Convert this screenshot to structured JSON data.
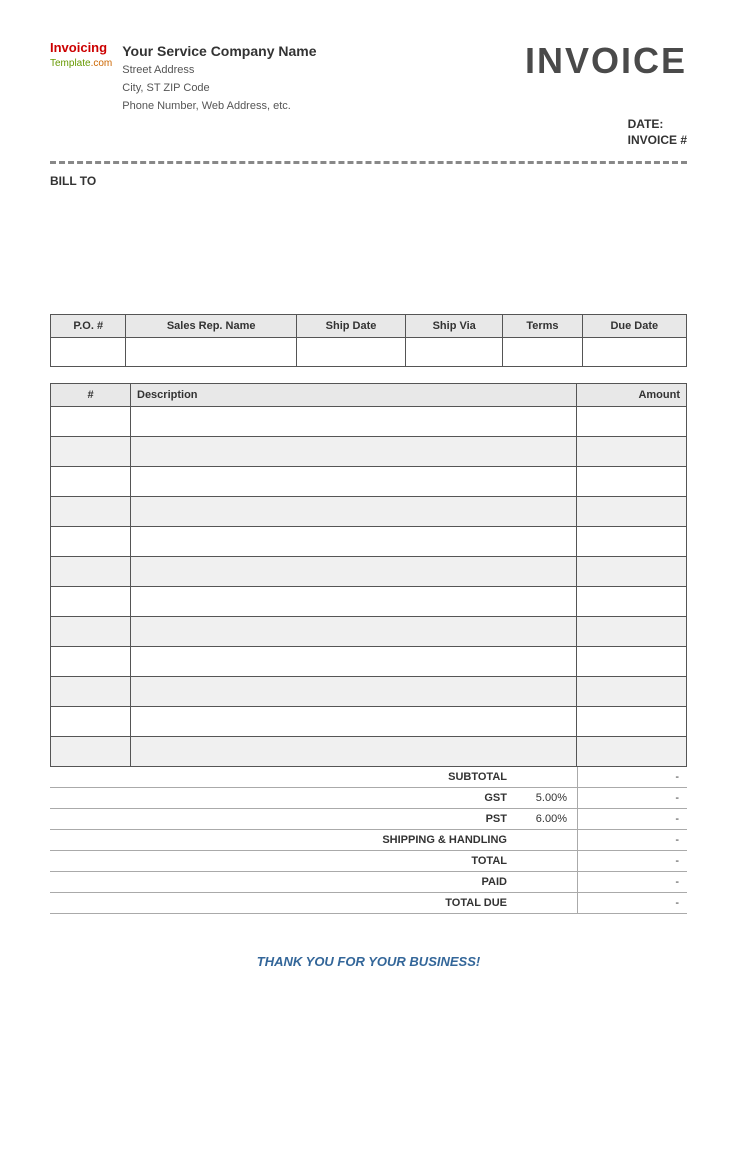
{
  "header": {
    "logo": {
      "invoicing_part1": "Invoicing",
      "template_part1": "Template",
      "template_part2": ".com"
    },
    "company": {
      "name": "Your Service Company Name",
      "street": "Street Address",
      "city": "City, ST  ZIP Code",
      "phone": "Phone Number, Web Address, etc."
    },
    "invoice_title": "INVOICE",
    "date_label": "DATE:",
    "invoice_num_label": "INVOICE #"
  },
  "bill_to": {
    "label": "BILL TO"
  },
  "info_table": {
    "columns": [
      "P.O. #",
      "Sales Rep. Name",
      "Ship Date",
      "Ship Via",
      "Terms",
      "Due Date"
    ],
    "row": [
      "",
      "",
      "",
      "",
      "",
      ""
    ]
  },
  "items_table": {
    "col_num": "#",
    "col_desc": "Description",
    "col_amt": "Amount",
    "rows": [
      {
        "num": "",
        "desc": "",
        "amt": ""
      },
      {
        "num": "",
        "desc": "",
        "amt": ""
      },
      {
        "num": "",
        "desc": "",
        "amt": ""
      },
      {
        "num": "",
        "desc": "",
        "amt": ""
      },
      {
        "num": "",
        "desc": "",
        "amt": ""
      },
      {
        "num": "",
        "desc": "",
        "amt": ""
      },
      {
        "num": "",
        "desc": "",
        "amt": ""
      },
      {
        "num": "",
        "desc": "",
        "amt": ""
      },
      {
        "num": "",
        "desc": "",
        "amt": ""
      },
      {
        "num": "",
        "desc": "",
        "amt": ""
      },
      {
        "num": "",
        "desc": "",
        "amt": ""
      },
      {
        "num": "",
        "desc": "",
        "amt": ""
      }
    ]
  },
  "totals": {
    "subtotal_label": "SUBTOTAL",
    "subtotal_value": "-",
    "gst_label": "GST",
    "gst_rate": "5.00%",
    "gst_value": "-",
    "pst_label": "PST",
    "pst_rate": "6.00%",
    "pst_value": "-",
    "shipping_label": "SHIPPING & HANDLING",
    "shipping_value": "-",
    "total_label": "TOTAL",
    "total_value": "-",
    "paid_label": "PAID",
    "paid_value": "-",
    "total_due_label": "TOTAL DUE",
    "total_due_value": "-"
  },
  "footer": {
    "thank_you": "THANK YOU FOR YOUR BUSINESS!"
  }
}
